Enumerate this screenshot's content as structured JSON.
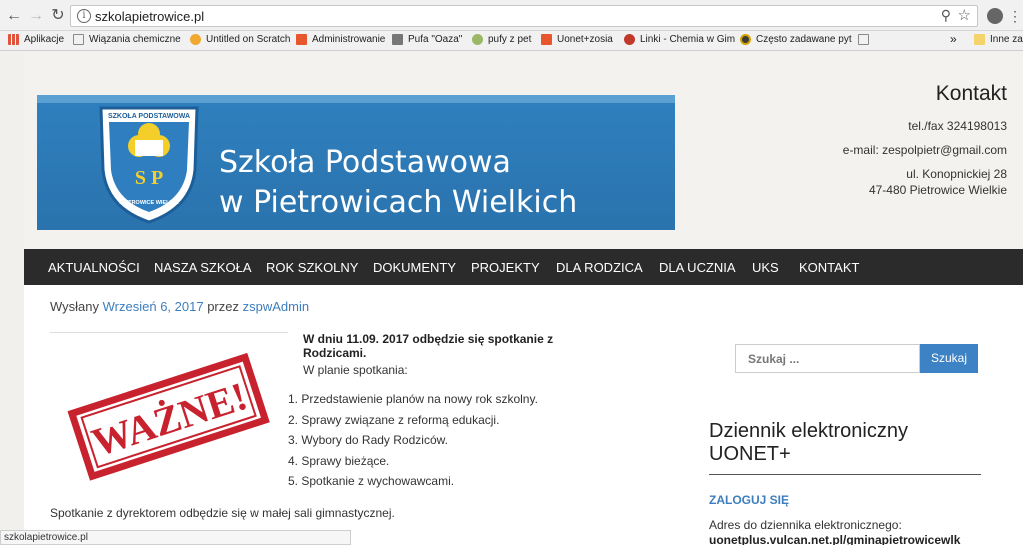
{
  "browser": {
    "url": "szkolapietrowice.pl",
    "status_url": "szkolapietrowice.pl",
    "bookmarks": [
      {
        "label": "Aplikacje",
        "color": "#e0533d"
      },
      {
        "label": "Wiązania chemiczne",
        "color": "#888888"
      },
      {
        "label": "Untitled on Scratch",
        "color": "#f0a830"
      },
      {
        "label": "Administrowanie",
        "color": "#e8562e"
      },
      {
        "label": "Pufa \"Oaza\"",
        "color": "#777777"
      },
      {
        "label": "pufy z pet",
        "color": "#9ab865"
      },
      {
        "label": "Uonet+zosia",
        "color": "#e8562e"
      },
      {
        "label": "Linki - Chemia w Gim",
        "color": "#c0392b"
      },
      {
        "label": "Często zadawane pyt",
        "color": "#d4a200"
      },
      {
        "label": "",
        "color": "#888888"
      }
    ],
    "bookmarks_more": "»",
    "other_bookmarks": "Inne zak"
  },
  "header": {
    "school_line1": "Szkoła Podstawowa",
    "school_line2": "w Pietrowicach Wielkich",
    "logo_top": "SZKOŁA PODSTAWOWA",
    "logo_side": "PIETROWICE WIELKIE",
    "logo_letters": "S P",
    "contact_title": "Kontakt",
    "tel": "tel./fax 324198013",
    "email": "e-mail: zespolpietr@gmail.com",
    "street": "ul. Konopnickiej 28",
    "city": "47-480 Pietrowice Wielkie"
  },
  "nav": [
    "AKTUALNOŚCI",
    "NASZA SZKOŁA",
    "ROK SZKOLNY",
    "DOKUMENTY",
    "PROJEKTY",
    "DLA RODZICA",
    "DLA UCZNIA",
    "UKS",
    "KONTAKT"
  ],
  "post": {
    "posted_prefix": "Wysłany",
    "date": "Wrzesień 6, 2017",
    "by": "przez",
    "author": "zspwAdmin",
    "stamp_text": "WAŻNE!",
    "lead": "W dniu 11.09. 2017 odbędzie się spotkanie z Rodzicami.",
    "sub": "W planie spotkania:",
    "items": [
      "1. Przedstawienie planów na nowy rok szkolny.",
      "2. Sprawy związane z reformą edukacji.",
      "3. Wybory do Rady Rodziców.",
      "4. Sprawy bieżące.",
      "5. Spotkanie z wychowawcami."
    ],
    "note": "Spotkanie z dyrektorem odbędzie się w małej sali gimnastycznej."
  },
  "sidebar": {
    "search_placeholder": "Szukaj ...",
    "search_button": "Szukaj",
    "widget_title_1": "Dziennik elektroniczny",
    "widget_title_2": "UONET+",
    "login": "ZALOGUJ SIĘ",
    "address_label": "Adres do dziennika elektronicznego:",
    "address_link": "uonetplus.vulcan.net.pl/gminapietrowicewlk"
  }
}
